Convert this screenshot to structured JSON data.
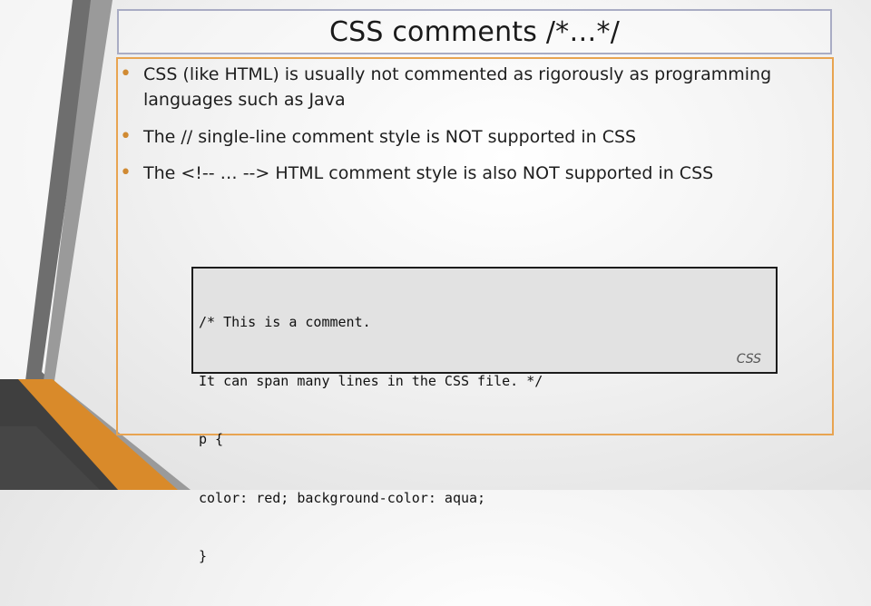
{
  "slide": {
    "title": "CSS comments /*…*/",
    "bullets": [
      {
        "line1": "CSS (like HTML) is usually not commented as rigorously as programming",
        "line2": "languages such as Java"
      },
      {
        "line1": "The // single-line comment style is NOT supported in CSS"
      },
      {
        "line1": "The <!-- … --> HTML comment style is also NOT supported in CSS"
      }
    ],
    "code": {
      "lines": [
        "/* This is a comment.",
        "It can span many lines in the CSS file. */",
        "p {",
        "color: red; background-color: aqua;",
        "}"
      ],
      "label": "CSS"
    },
    "colors": {
      "accent": "#e8a451",
      "title_border": "#a9acc4"
    }
  }
}
